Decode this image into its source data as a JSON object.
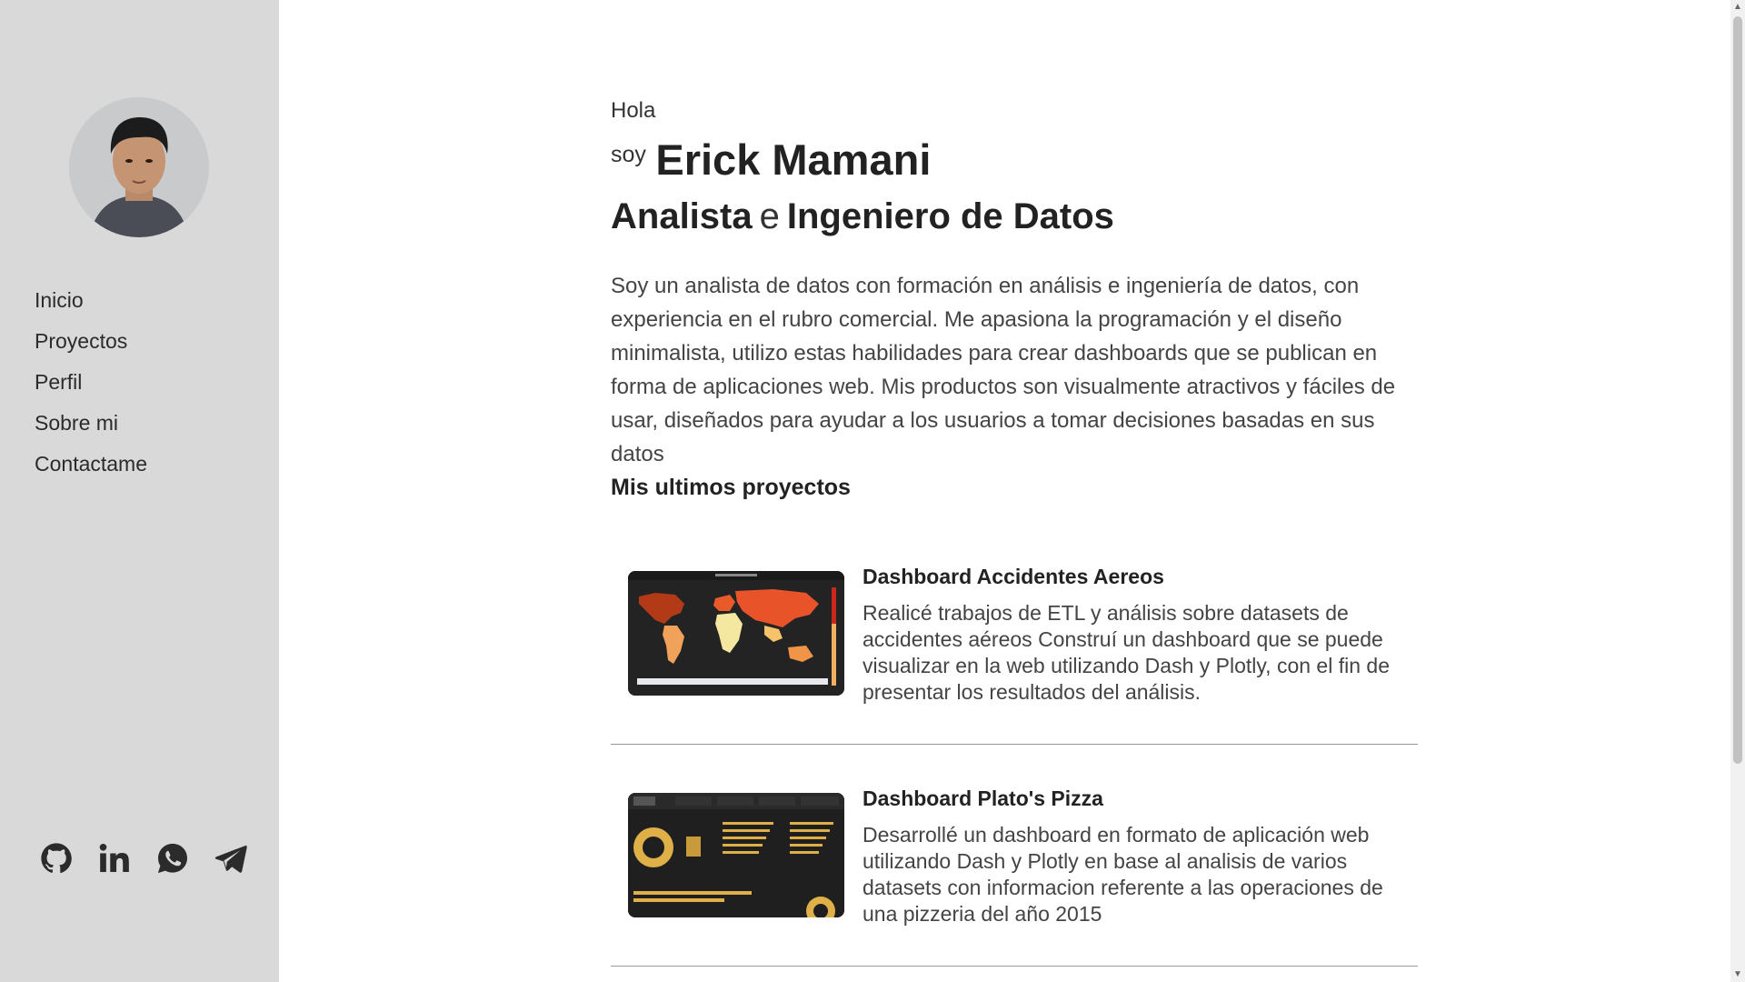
{
  "sidebar": {
    "nav": [
      {
        "label": "Inicio"
      },
      {
        "label": "Proyectos"
      },
      {
        "label": "Perfil"
      },
      {
        "label": "Sobre mi"
      },
      {
        "label": "Contactame"
      }
    ],
    "social_icons": [
      "github-icon",
      "linkedin-icon",
      "whatsapp-icon",
      "telegram-icon"
    ]
  },
  "hero": {
    "greeting": "Hola",
    "soy": "soy",
    "name": "Erick Mamani",
    "role_1": "Analista",
    "role_conj": "e",
    "role_2": "Ingeniero de Datos",
    "intro": "Soy un analista de datos con formación en análisis e ingeniería de datos, con experiencia en el rubro comercial. Me apasiona la programación y el diseño minimalista, utilizo estas habilidades para crear dashboards que se publican en forma de aplicaciones web. Mis productos son visualmente atractivos y fáciles de usar, diseñados para ayudar a los usuarios a tomar decisiones basadas en sus datos"
  },
  "projects": {
    "section_title": "Mis ultimos proyectos",
    "items": [
      {
        "title": "Dashboard Accidentes Aereos",
        "description": "Realicé trabajos de ETL y análisis sobre datasets de accidentes aéreos Construí un dashboard que se puede visualizar en la web utilizando Dash y Plotly, con el fin de presentar los resultados del análisis."
      },
      {
        "title": "Dashboard Plato's Pizza",
        "description": "Desarrollé un dashboard en formato de aplicación web utilizando Dash y Plotly en base al analisis de varios datasets con informacion referente a las operaciones de una pizzeria del año 2015"
      }
    ]
  },
  "colors": {
    "sidebar_bg": "#d9d9d9",
    "text_dark": "#222222",
    "divider": "#999999"
  }
}
